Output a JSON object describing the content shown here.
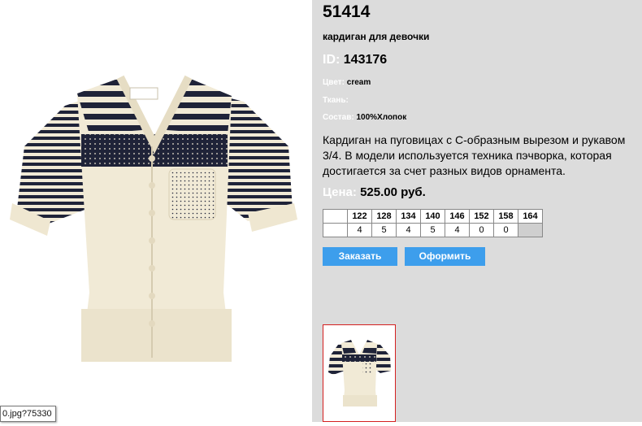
{
  "tooltip": "0.jpg?75330",
  "product": {
    "id_title": "51414",
    "name": "кардиган для девочки",
    "id_label": "ID:",
    "id_value": "143176",
    "color_label": "Цвет:",
    "color_value": "cream",
    "fabric_label": "Ткань:",
    "fabric_value": "",
    "composition_label": "Состав:",
    "composition_value": "100%Хлопок",
    "description": "Кардиган на пуговицах с С-образным вырезом и рукавом 3/4. В модели используется техника пэчворка, которая достигается за счет разных видов орнамента.",
    "price_label": "Цена:",
    "price_value": "525.00 руб."
  },
  "sizes": {
    "headers": [
      "122",
      "128",
      "134",
      "140",
      "146",
      "152",
      "158",
      "164"
    ],
    "quantities": [
      "4",
      "5",
      "4",
      "5",
      "4",
      "0",
      "0",
      ""
    ]
  },
  "buttons": {
    "order": "Заказать",
    "checkout": "Оформить"
  },
  "colors": {
    "panel_bg": "#dcdcdc",
    "button_bg": "#3d9eec",
    "thumb_border": "#d42020",
    "sweater_cream": "#f1ead6",
    "stripe_navy": "#1f2338"
  }
}
